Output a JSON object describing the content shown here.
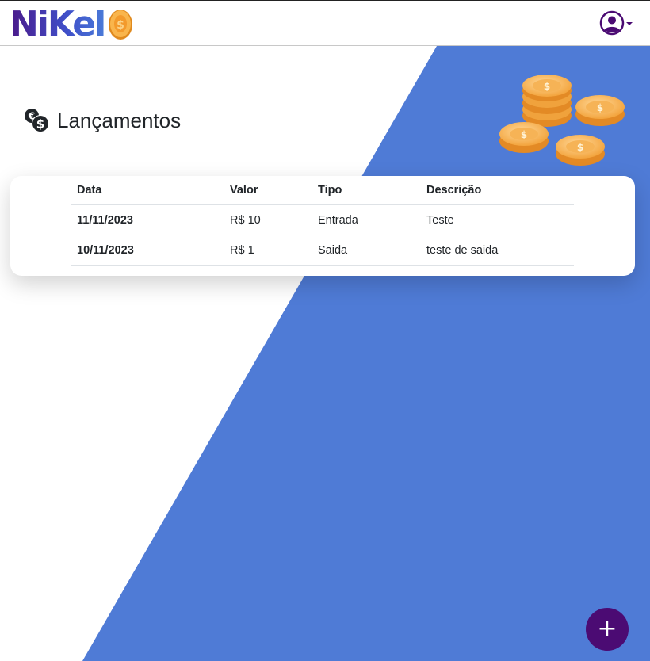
{
  "header": {
    "logo_text": "NiKel",
    "logo_icon": "coin-icon",
    "user_icon": "user-circle-icon"
  },
  "page": {
    "title": "Lançamentos",
    "title_icon": "coins-icon"
  },
  "table": {
    "headers": [
      "Data",
      "Valor",
      "Tipo",
      "Descrição"
    ],
    "rows": [
      [
        "11/11/2023",
        "R$ 10",
        "Entrada",
        "Teste"
      ],
      [
        "10/11/2023",
        "R$ 1",
        "Saida",
        "teste de saida"
      ]
    ]
  },
  "fab": {
    "label": "+"
  },
  "colors": {
    "primary": "#4b0b73",
    "background_accent": "#4f7bd6",
    "coin_gold": "#f7b24a"
  }
}
